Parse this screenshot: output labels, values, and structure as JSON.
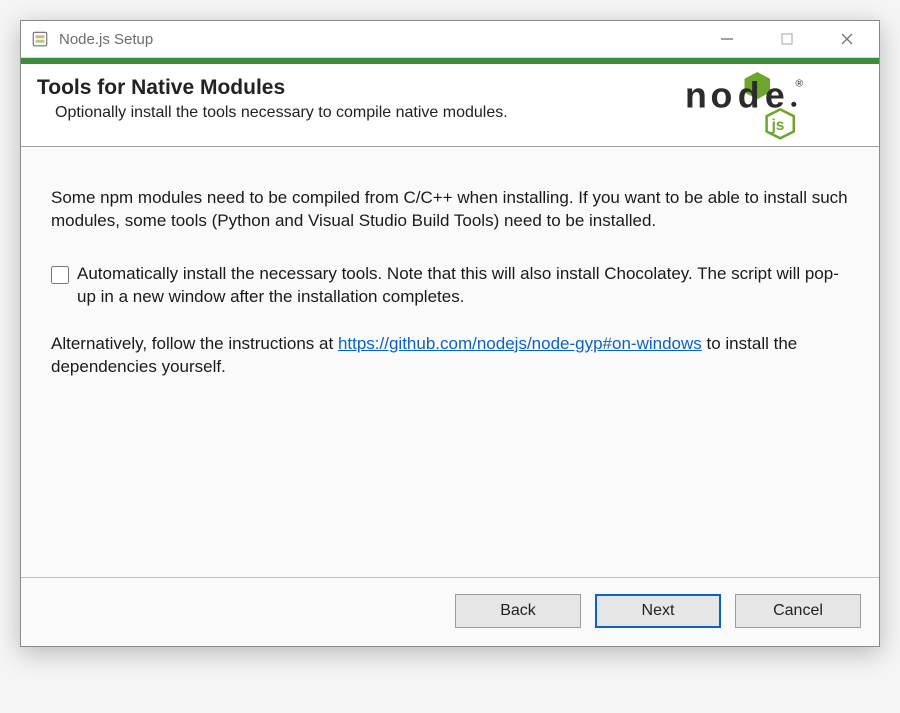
{
  "window": {
    "title": "Node.js Setup"
  },
  "header": {
    "heading": "Tools for Native Modules",
    "subheading": "Optionally install the tools necessary to compile native modules."
  },
  "content": {
    "intro": "Some npm modules need to be compiled from C/C++ when installing. If you want to be able to install such modules, some tools (Python and Visual Studio Build Tools) need to be installed.",
    "checkbox_label": "Automatically install the necessary tools. Note that this will also install Chocolatey. The script will pop-up in a new window after the installation completes.",
    "alt_prefix": "Alternatively, follow the instructions at ",
    "alt_link_text": "https://github.com/nodejs/node-gyp#on-windows",
    "alt_suffix": " to install the dependencies yourself."
  },
  "buttons": {
    "back": "Back",
    "next": "Next",
    "cancel": "Cancel"
  }
}
